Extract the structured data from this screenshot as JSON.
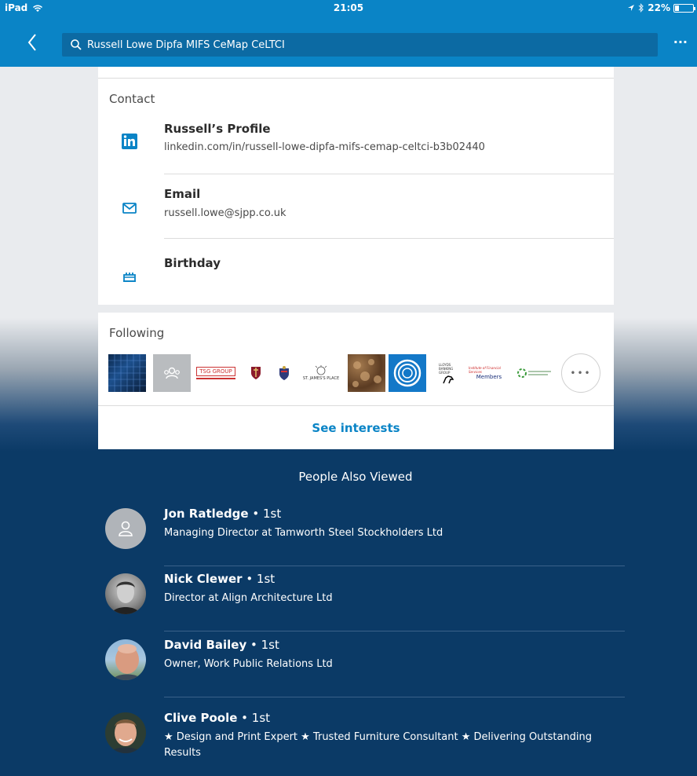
{
  "status_bar": {
    "device": "iPad",
    "time": "21:05",
    "battery": "22%",
    "battery_level": 0.22
  },
  "nav": {
    "search_value": "Russell Lowe Dipfa MIFS CeMap CeLTCI",
    "more": "···"
  },
  "contact": {
    "title": "Contact",
    "items": [
      {
        "label": "Russell’s Profile",
        "value": "linkedin.com/in/russell-lowe-dipfa-mifs-cemap-celtci-b3b02440",
        "icon": "linkedin-icon"
      },
      {
        "label": "Email",
        "value": "russell.lowe@sjpp.co.uk",
        "icon": "envelope-icon"
      },
      {
        "label": "Birthday",
        "value": "",
        "icon": "birthday-cake-icon"
      }
    ]
  },
  "following": {
    "title": "Following",
    "logos": [
      {
        "name": "logo-building"
      },
      {
        "name": "logo-group-placeholder"
      },
      {
        "name": "logo-tsg-group",
        "text": "TSG GROUP"
      },
      {
        "name": "logo-crest"
      },
      {
        "name": "logo-crest-2"
      },
      {
        "name": "logo-st-james-place",
        "text": "ST. JAMES'S PLACE"
      },
      {
        "name": "logo-brown-pattern"
      },
      {
        "name": "logo-blue-circles"
      },
      {
        "name": "logo-lloyds-banking",
        "text": "LLOYDS BANKING GROUP"
      },
      {
        "name": "logo-members",
        "text": "Members"
      },
      {
        "name": "logo-green"
      }
    ],
    "see_interests": "See interests"
  },
  "people_also_viewed": {
    "title": "People Also Viewed",
    "people": [
      {
        "name": "Jon Ratledge",
        "degree": " • 1st",
        "headline": "Managing Director at Tamworth Steel Stockholders Ltd"
      },
      {
        "name": "Nick Clewer",
        "degree": " • 1st",
        "headline": "Director at Align Architecture Ltd"
      },
      {
        "name": "David Bailey",
        "degree": " • 1st",
        "headline": "Owner, Work Public Relations Ltd"
      },
      {
        "name": "Clive Poole",
        "degree": " • 1st",
        "headline": "★ Design and Print Expert ★ Trusted Furniture Consultant ★ Delivering Outstanding Results"
      }
    ]
  },
  "colors": {
    "brand_blue": "#0a84c6",
    "dark_navy": "#0b3a66"
  }
}
